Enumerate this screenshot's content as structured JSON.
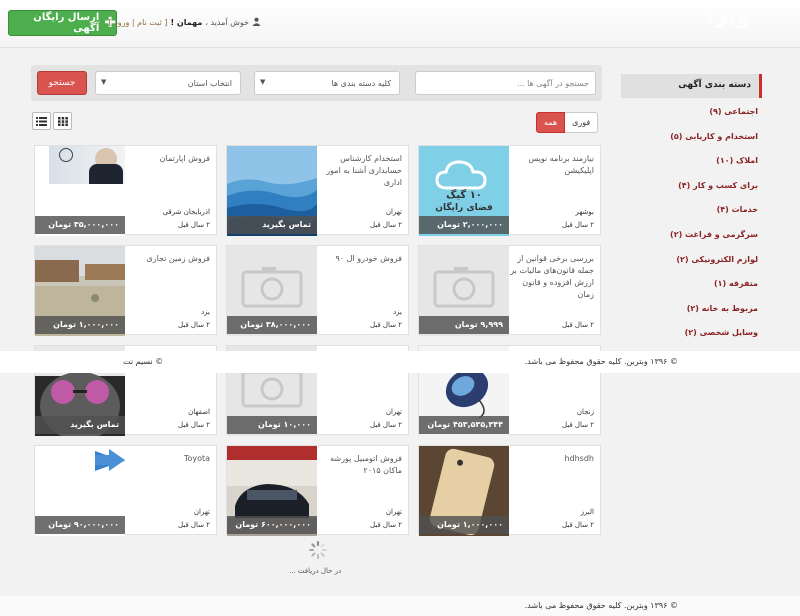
{
  "header": {
    "post_button": "ارسال رایگان آگهی",
    "welcome": "خوش آمدید ،",
    "guest": "مهمان !",
    "register_login": "[ ثبت نام | ورود ]",
    "brand": "وبرد"
  },
  "search": {
    "placeholder": "جستجو در آگهی ها ...",
    "category_select": "کلیه دسته بندی ها",
    "province_select": "انتخاب استان",
    "button": "جستجو"
  },
  "filters": {
    "all": "همه",
    "urgent": "فوری"
  },
  "sidebar": {
    "heading": "دسته بندی آگهی",
    "items": [
      {
        "label": "اجتماعی (۹)"
      },
      {
        "label": "استخدام و کاریابی (۵)"
      },
      {
        "label": "املاک (۱۰)"
      },
      {
        "label": "برای کسب و کار (۴)"
      },
      {
        "label": "خدمات (۴)"
      },
      {
        "label": "سرگرمی و فراغت (۲)"
      },
      {
        "label": "لوازم الکترونیکی (۲)"
      },
      {
        "label": "متفرقه (۱)"
      },
      {
        "label": "مربوط به خانه (۲)"
      },
      {
        "label": "وسایل شخصی (۲)"
      }
    ]
  },
  "ads": [
    {
      "title": "فروش اپارتمان",
      "location": "اذربایجان شرقی",
      "time": "۲ سال قبل",
      "price": "۳۵,۰۰۰,۰۰۰ تومان"
    },
    {
      "title": "استخدام کارشناس حسابداری آشنا به امور اداری",
      "location": "تهران",
      "time": "۲ سال قبل",
      "price": "تماس بگیرید"
    },
    {
      "title": "نیازمند برنامه نویس اپلیکیشن",
      "location": "بوشهر",
      "time": "۲ سال قبل",
      "price": "۲,۰۰۰,۰۰۰ تومان"
    },
    {
      "title": "فروش زمین تجاری",
      "location": "یزد",
      "time": "۲ سال قبل",
      "price": "۱,۰۰۰,۰۰۰ تومان"
    },
    {
      "title": "فروش خودرو ال ۹۰",
      "location": "یزد",
      "time": "۲ سال قبل",
      "price": "۳۸,۰۰۰,۰۰۰ تومان"
    },
    {
      "title": "بررسی برخی قوانین از جمله قانون‌های مالیات بر ارزش افزوده و قانون زمان",
      "location": "تهران",
      "time": "۲ سال قبل",
      "price": "۹,۹۹۹ تومان"
    },
    {
      "title": "",
      "location": "اصفهان",
      "time": "۲ سال قبل",
      "price": "تماس بگیرید"
    },
    {
      "title": "",
      "location": "تهران",
      "time": "۲ سال قبل",
      "price": "۱۰,۰۰۰ تومان"
    },
    {
      "title": "",
      "location": "زنجان",
      "time": "۲ سال قبل",
      "price": "۴۵۳,۵۳۵,۳۴۴ تومان"
    },
    {
      "title": "Toyota",
      "location": "تهران",
      "time": "۲ سال قبل",
      "price": "۹۰,۰۰۰,۰۰۰ تومان"
    },
    {
      "title": "فروش اتومبیل پورشه ماکان ۲۰۱۵",
      "location": "تهران",
      "time": "۲ سال قبل",
      "price": "۶۰۰,۰۰۰,۰۰۰ تومان"
    },
    {
      "title": "hdhsdh",
      "location": "البرز",
      "time": "۲ سال قبل",
      "price": "۱,۰۰۰,۰۰۰ تومان"
    }
  ],
  "cloud_banner": {
    "line1": "۱۰ گیگ",
    "line2": "فضای رایگان"
  },
  "band": {
    "copyright": "© ۱۳۹۶ وبتربن. کلیه حقوق محفوظ می باشد.",
    "credit": "© نسیم نت"
  },
  "loading_text": "در حال دریافت ...",
  "footer": {
    "copyright": "© ۱۳۹۶ وبتربن. کلیه حقوق محفوظ می باشد."
  },
  "colors": {
    "accent": "#d9534f",
    "green": "#4cae4c",
    "category_text": "#8b2323"
  }
}
